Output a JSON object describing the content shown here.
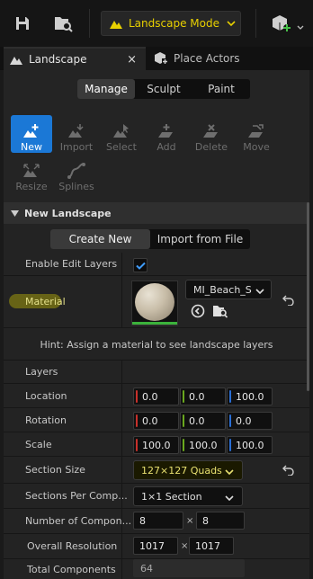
{
  "toolbar": {
    "save_icon": "save-icon",
    "browse_icon": "content-browser-icon",
    "mode_label": "Landscape Mode",
    "add_icon": "add-actor-icon"
  },
  "tabs": [
    {
      "label": "Landscape",
      "close": "×"
    },
    {
      "label": "Place Actors"
    }
  ],
  "modes": [
    "Manage",
    "Sculpt",
    "Paint"
  ],
  "tools": [
    {
      "label": "New"
    },
    {
      "label": "Import"
    },
    {
      "label": "Select"
    },
    {
      "label": "Add"
    },
    {
      "label": "Delete"
    },
    {
      "label": "Move"
    },
    {
      "label": "Resize"
    },
    {
      "label": "Splines"
    }
  ],
  "section": {
    "title": "New Landscape"
  },
  "create_mode": [
    "Create New",
    "Import from File"
  ],
  "props": {
    "enable_edit_layers": {
      "label": "Enable Edit Layers"
    },
    "material": {
      "label": "Material",
      "value": "MI_Beach_S"
    },
    "hint": "Hint: Assign a material to see landscape layers",
    "layers": {
      "label": "Layers"
    },
    "location": {
      "label": "Location",
      "x": "0.0",
      "y": "0.0",
      "z": "100.0"
    },
    "rotation": {
      "label": "Rotation",
      "x": "0.0",
      "y": "0.0",
      "z": "0.0"
    },
    "scale": {
      "label": "Scale",
      "x": "100.0",
      "y": "100.0",
      "z": "100.0"
    },
    "section_size": {
      "label": "Section Size",
      "value": "127×127 Quads"
    },
    "sections_per_comp": {
      "label": "Sections Per Comp...",
      "value": "1×1 Section"
    },
    "num_components": {
      "label": "Number of Compon...",
      "x": "8",
      "y": "8",
      "sep": "×"
    },
    "overall_res": {
      "label": "Overall Resolution",
      "x": "1017",
      "y": "1017",
      "sep": "×"
    },
    "total_components": {
      "label": "Total Components",
      "value": "64"
    }
  },
  "colors": {
    "accent": "#1b78d6",
    "mode_text": "#e8d000",
    "x_axis": "#c8302a",
    "y_axis": "#6aa81e",
    "z_axis": "#2a6fd6"
  }
}
